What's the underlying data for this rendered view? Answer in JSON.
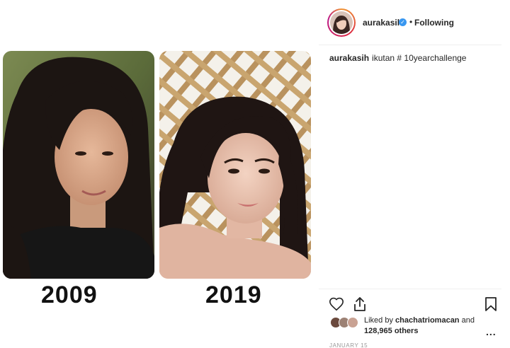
{
  "media": {
    "left_year": "2009",
    "right_year": "2019"
  },
  "post": {
    "username": "aurakasih",
    "separator": "•",
    "follow_status": "Following",
    "caption_user": "aurakasih",
    "caption_text": "ikutan # 10yearchallenge",
    "liked_prefix": "Liked by",
    "liked_user": "chachatriomacan",
    "liked_and": "and",
    "liked_count": "128,965 others",
    "date": "JANUARY 15",
    "more_label": "..."
  },
  "colors": {
    "verified": "#3897f0",
    "text": "#262626",
    "muted": "#999999"
  },
  "icons": [
    "heart-icon",
    "share-icon",
    "bookmark-icon",
    "verified-icon",
    "more-options-icon"
  ]
}
